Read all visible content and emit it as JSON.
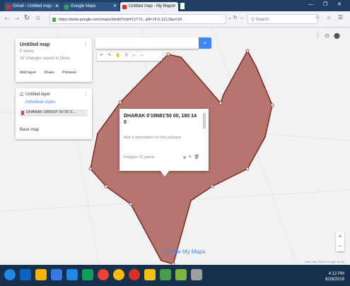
{
  "browser": {
    "tabs": [
      {
        "label": "Gmail - Untitled map - ...",
        "favicon_color": "#d93025"
      },
      {
        "label": "Google Maps",
        "favicon_color": "#34a853"
      },
      {
        "label": "Untitled map - My Maps",
        "favicon_color": "#d93025"
      }
    ],
    "url": "https://www.google.com/maps/d/edit?mid=1xY7z...&ll=14.5,121.0&z=18",
    "search_placeholder": "Q Search",
    "window_controls": "— ❐ ✕"
  },
  "panel": {
    "map_title": "Untitled map",
    "map_subtitle": "0 views",
    "map_desc": "All changes saved in Drive",
    "actions": [
      "Add layer",
      "Share",
      "Preview"
    ],
    "layer_name": "Untitled layer",
    "layer_link": "Individual styles",
    "layer_item": "DHARAK ORIENT 50 00 S...",
    "base_map": "Base map"
  },
  "popup": {
    "title": "DHARAK 0'19N81'50 00, 180 14 0",
    "desc": "Add a description for this polygon",
    "meta": "Polygon 12 points"
  },
  "map": {
    "polygon_color": "#a85a52",
    "logo": "Google My Maps",
    "footer": "Map data ©2018 Google  Terms"
  },
  "taskbar": {
    "time": "4:12 PM",
    "date": "6/28/2018",
    "icons": [
      "#1e88e5",
      "#0b64c0",
      "#f4b400",
      "#3b78e7",
      "#1e88e5",
      "#0f9d58",
      "#ea4335",
      "#fbbc05",
      "#d93025",
      "#f1c40f",
      "#43a047",
      "#7cb342",
      "#9e9e9e"
    ]
  }
}
